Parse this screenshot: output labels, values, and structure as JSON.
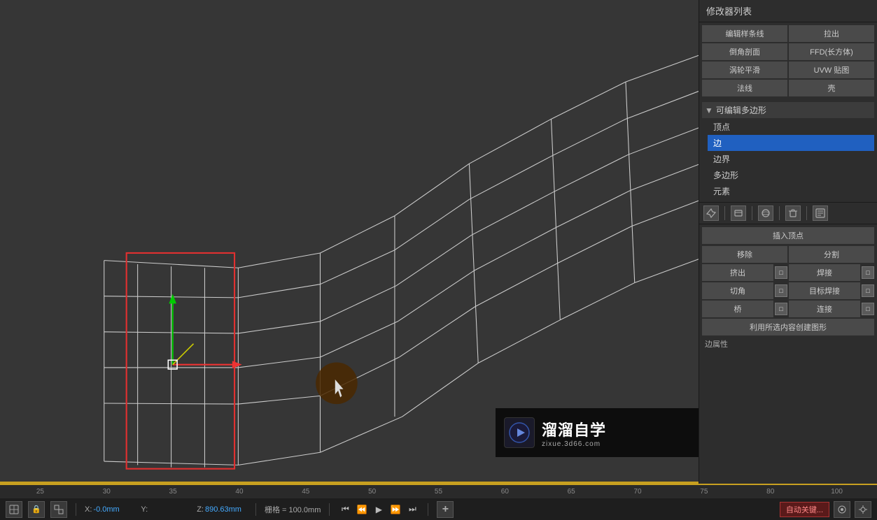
{
  "panel": {
    "title": "修改器列表",
    "buttons": [
      {
        "id": "edit-spline",
        "label": "编辑样条线"
      },
      {
        "id": "extrude",
        "label": "拉出"
      },
      {
        "id": "chamfer",
        "label": "倒角剖面"
      },
      {
        "id": "ffd",
        "label": "FFD(长方体)"
      },
      {
        "id": "turbosmooth",
        "label": "涡轮平滑"
      },
      {
        "id": "uvw",
        "label": "UVW 贴图"
      },
      {
        "id": "normal",
        "label": "法线"
      },
      {
        "id": "shell",
        "label": "壳"
      }
    ],
    "poly": {
      "header": "可编辑多边形",
      "items": [
        {
          "id": "vertex",
          "label": "顶点",
          "active": false
        },
        {
          "id": "edge",
          "label": "边",
          "active": true
        },
        {
          "id": "border",
          "label": "边界",
          "active": false
        },
        {
          "id": "polygon",
          "label": "多边形",
          "active": false
        },
        {
          "id": "element",
          "label": "元素",
          "active": false
        }
      ]
    },
    "icons": [
      "pin",
      "cylinder",
      "sphere",
      "trash",
      "edit"
    ],
    "ops": {
      "insert_vertex": "插入顶点",
      "remove": "移除",
      "split": "分割",
      "extrude": "挤出",
      "weld": "焊接",
      "chamfer": "切角",
      "target_weld": "目标焊接",
      "bridge": "桥",
      "connect": "连接",
      "create_shape": "利用所选内容创建图形",
      "edge_props": "边属性"
    }
  },
  "timeline": {
    "numbers": [
      "25",
      "30",
      "35",
      "40",
      "45",
      "50",
      "55",
      "60",
      "65",
      "70",
      "75",
      "80",
      "100"
    ]
  },
  "status": {
    "x_label": "X:",
    "x_val": "-0.0mm",
    "y_label": "Y:",
    "y_val": "",
    "z_label": "Z:",
    "z_val": "890.63mm",
    "grid": "栅格 = 100.0mm",
    "autokey": "自动关键..."
  },
  "watermark": {
    "title": "溜溜自学",
    "subtitle": "zixue.3d66.com",
    "logo_text": "▶"
  }
}
